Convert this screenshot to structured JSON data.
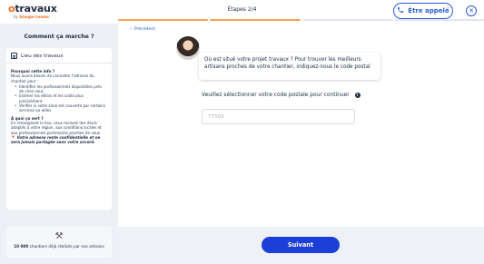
{
  "header": {
    "logo_prefix": "o",
    "logo_main": "travaux",
    "logo_sub_prefix": "by",
    "logo_sub_brand": "Groupe Leamo",
    "steps": "Étapes 2/4",
    "call_button": "Être appelé",
    "close_icon": "close-icon",
    "phone_icon": "phone-icon",
    "progress": {
      "total_segments": 4,
      "completed": 2
    }
  },
  "sidebar": {
    "title": "Comment ça marche ?",
    "card": {
      "title": "Lieu des travaux",
      "q1": "Pourquoi cette info ?",
      "p1": "Nous avons besoin de connaître l'adresse du chantier pour :",
      "bullets": [
        "Identifier les professionnels disponibles près de chez vous",
        "Estimer les délais et les coûts plus précisément",
        "Vérifier si votre zone est couverte par certains services ou aides"
      ],
      "q2": "À quoi ça sert ?",
      "p2": "En renseignant le lieu, vous recevez des devis adaptés à votre région, aux conditions locales et aux professionnels partenaires proches de vous.",
      "note": "Votre adresse reste confidentielle et ne sera jamais partagée sans votre accord."
    },
    "stat": {
      "count": "10 000",
      "text": "chantiers déjà réalisés par nos artisans"
    }
  },
  "main": {
    "back_label": "Précédent",
    "question": "Où est situé votre projet travaux ? Pour trouver les meilleurs artisans proches de votre chantier, indiquez-nous le code postal",
    "field_label": "Veuillez sélectionner votre code postale pour continuer",
    "postal_placeholder": "77500",
    "postal_value": "",
    "submit_label": "Suivant"
  },
  "colors": {
    "accent": "#2a5bd7",
    "button": "#1c3fd8",
    "brand_orange": "#f26b1d",
    "progress_done": "#f5a25d",
    "sidebar_bg": "#edf0f5"
  }
}
